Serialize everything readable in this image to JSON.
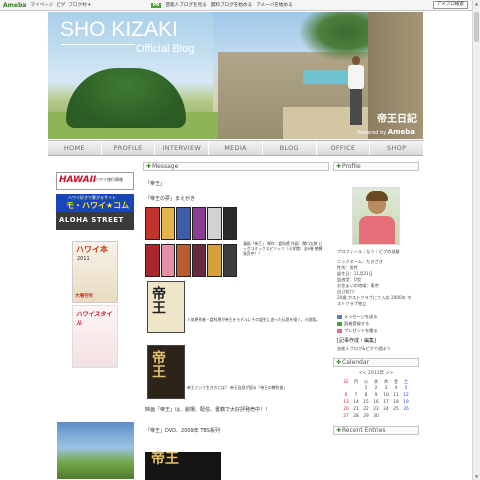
{
  "topbar": {
    "logo": "Ameba",
    "nav": [
      "マイページ",
      "ピグ",
      "ブログ村 ▾"
    ],
    "ad_tag": "PR",
    "ad_text_1": "芸能人ブログを見る",
    "ad_text_2": "無料ブログを始める",
    "ad_text_3": "アメーバを始める",
    "search_button": "アメブロ検索"
  },
  "banner": {
    "title": "SHO KIZAKI",
    "subtitle": "Official Blog",
    "diary": "帝王日記",
    "powered_prefix": "Powered by",
    "powered_brand": "Ameba"
  },
  "tabs": [
    "HOME",
    "PROFILE",
    "INTERVIEW",
    "MEDIA",
    "BLOG",
    "OFFICE",
    "SHOP"
  ],
  "left_ads": {
    "hawaii_title": "HAWAII",
    "hawaii_sub": "ハワイ旅行情報",
    "mohawaii_sub": "ハワイ好きで繋がるサイト",
    "mohawaii_title": "モ・ハワイ★コム",
    "aloha_title": "ALOHA STREET",
    "book1_title": "ハワイ本",
    "book1_year": "2011",
    "book1_badge": "大増刊号",
    "book2_title": "ハワイスタイル"
  },
  "message": {
    "heading": "Message",
    "p1": "「帝王」",
    "p2": "「帝王の夢」まえがき",
    "manga_caption": "漫画「帝王」 原作：倉科遼 作画：関口太郎 ビッグコミックスピリッツ（小学館）全8巻 絶賛発売中！！",
    "cover1_kanji": "帝王",
    "cover1_caption": "人気原作者・倉科遼が帝王をモデルにその誕生に迫った伝説を描く。小説版。",
    "cover2_kanji": "帝王",
    "cover2_caption": "帝王という生き方とは？ 帝王自身が語る「帝王の教科書」",
    "p3": "映画「帝王」は、劇場、配信、書籍で大好評発売中！！",
    "p4": "「帝王」DVD、2009年 TBS系列",
    "dvd_kanji": "帝王"
  },
  "profile": {
    "heading": "Profile",
    "lines": [
      "プロフィール｜なう｜ピグの部屋",
      "ニックネーム：たきざき",
      "性別：男性",
      "誕生日：11月21日",
      "血液型：O型",
      "お住まいの地域：東京",
      "自己紹介：",
      "20歳 ホストクラブにて入店 2000年 ホストクラブ独立"
    ],
    "link_message": "メッセージを送る",
    "link_reader": "読者登録する",
    "link_present": "プレゼントを贈る",
    "feed_title": "[記事作成・編集]",
    "feed_sub": "芸能人ブログ&ピグで遊ぼう"
  },
  "calendar": {
    "heading": "Calendar",
    "month": "<< 2011年 >>",
    "weekdays": [
      "日",
      "月",
      "火",
      "水",
      "木",
      "金",
      "土"
    ],
    "rows": [
      [
        "",
        "",
        "1",
        "2",
        "3",
        "4",
        "5"
      ],
      [
        "6",
        "7",
        "8",
        "9",
        "10",
        "11",
        "12"
      ],
      [
        "13",
        "14",
        "15",
        "16",
        "17",
        "18",
        "19"
      ],
      [
        "20",
        "21",
        "22",
        "23",
        "24",
        "25",
        "26"
      ],
      [
        "27",
        "28",
        "29",
        "30",
        "",
        "",
        ""
      ]
    ]
  },
  "recent": {
    "heading": "Recent Entries"
  },
  "colors": {
    "ameba_green": "#2f7d1d",
    "tab_text": "#6b6b6b",
    "sunday": "#d0202a",
    "saturday": "#2a48c8"
  }
}
